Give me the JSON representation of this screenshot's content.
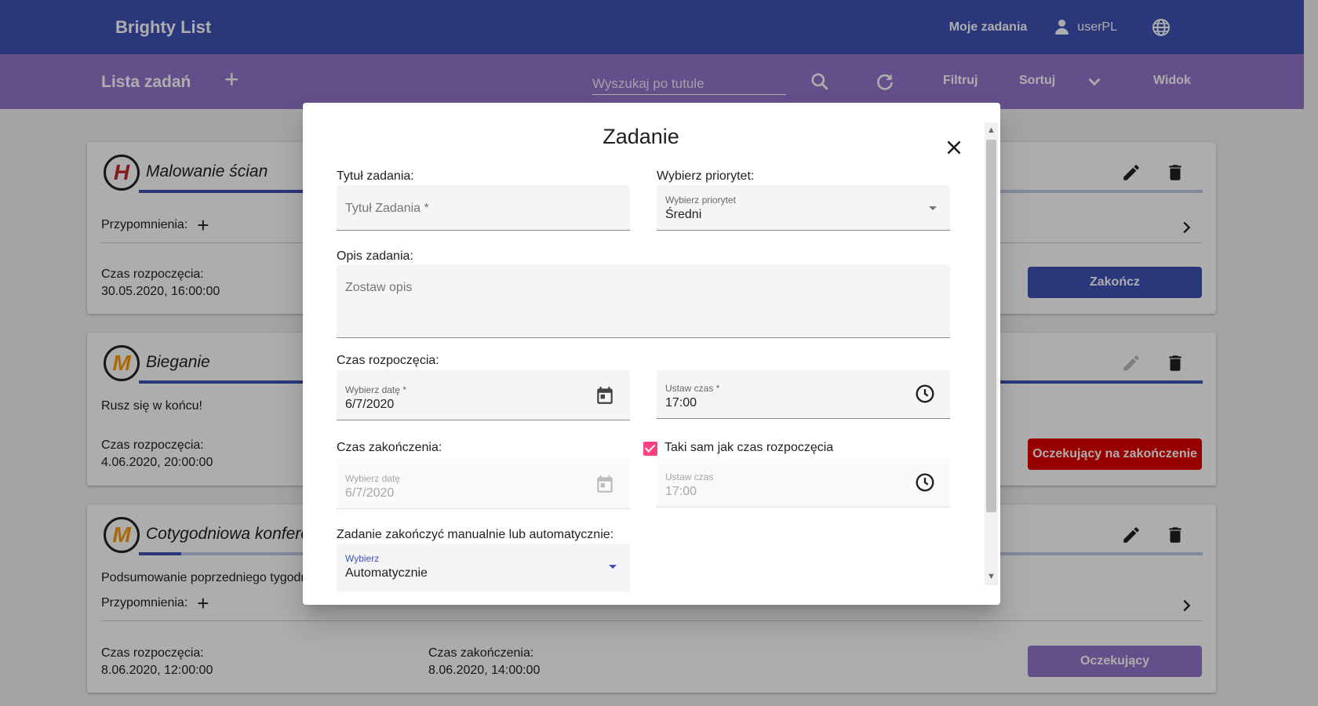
{
  "app": {
    "brand": "Brighty List"
  },
  "nav": {
    "my_tasks": "Moje zadania",
    "username": "userPL"
  },
  "toolbar": {
    "title": "Lista zadań",
    "search_placeholder": "Wyszukaj po tutule",
    "filter": "Filtruj",
    "sort": "Sortuj",
    "view": "Widok"
  },
  "cards": [
    {
      "priority": "H",
      "priority_color": "#c62828",
      "title": "Malowanie ścian",
      "progress": 0.2,
      "reminders_label": "Przypomnienia:",
      "start_label": "Czas rozpoczęcia:",
      "start_value": "30.05.2020, 16:00:00",
      "button": "Zakończ",
      "button_color": "#3f51b5"
    },
    {
      "priority": "M",
      "priority_color": "#ff9800",
      "title": "Bieganie",
      "progress": 1.0,
      "description": "Rusz się w końcu!",
      "start_label": "Czas rozpoczęcia:",
      "start_value": "4.06.2020, 20:00:00",
      "button": "Oczekujący na zakończenie",
      "button_color": "#e10000"
    },
    {
      "priority": "M",
      "priority_color": "#ff9800",
      "title": "Cotygodniowa konferencja",
      "progress": 0.04,
      "description": "Podsumowanie poprzedniego tygodnia",
      "reminders_label": "Przypomnienia:",
      "start_label": "Czas rozpoczęcia:",
      "start_value": "8.06.2020, 12:00:00",
      "end_label": "Czas zakończenia:",
      "end_value": "8.06.2020, 14:00:00",
      "button": "Oczekujący",
      "button_color": "#9575cd"
    }
  ],
  "dialog": {
    "title": "Zadanie",
    "task_title_label": "Tytuł zadania:",
    "task_title_placeholder": "Tytuł Zadania *",
    "priority_label": "Wybierz priorytet:",
    "priority_float": "Wybierz priorytet",
    "priority_value": "Średni",
    "description_label": "Opis zadania:",
    "description_placeholder": "Zostaw opis",
    "start_label": "Czas rozpoczęcia:",
    "start_date_float": "Wybierz datę *",
    "start_date_value": "6/7/2020",
    "start_time_float": "Ustaw czas *",
    "start_time_value": "17:00",
    "end_label": "Czas zakończenia:",
    "same_as_start_label": "Taki sam jak czas rozpoczęcia",
    "same_as_start_checked": true,
    "end_date_float": "Wybierz datę",
    "end_date_value": "6/7/2020",
    "end_time_float": "Ustaw czas",
    "end_time_value": "17:00",
    "completion_label": "Zadanie zakończyć manualnie lub automatycznie:",
    "completion_float": "Wybierz",
    "completion_value": "Automatycznie"
  },
  "colors": {
    "primary": "#3f51b5",
    "secondary": "#9575cd",
    "accent": "#ff4081",
    "warn": "#e10000"
  }
}
